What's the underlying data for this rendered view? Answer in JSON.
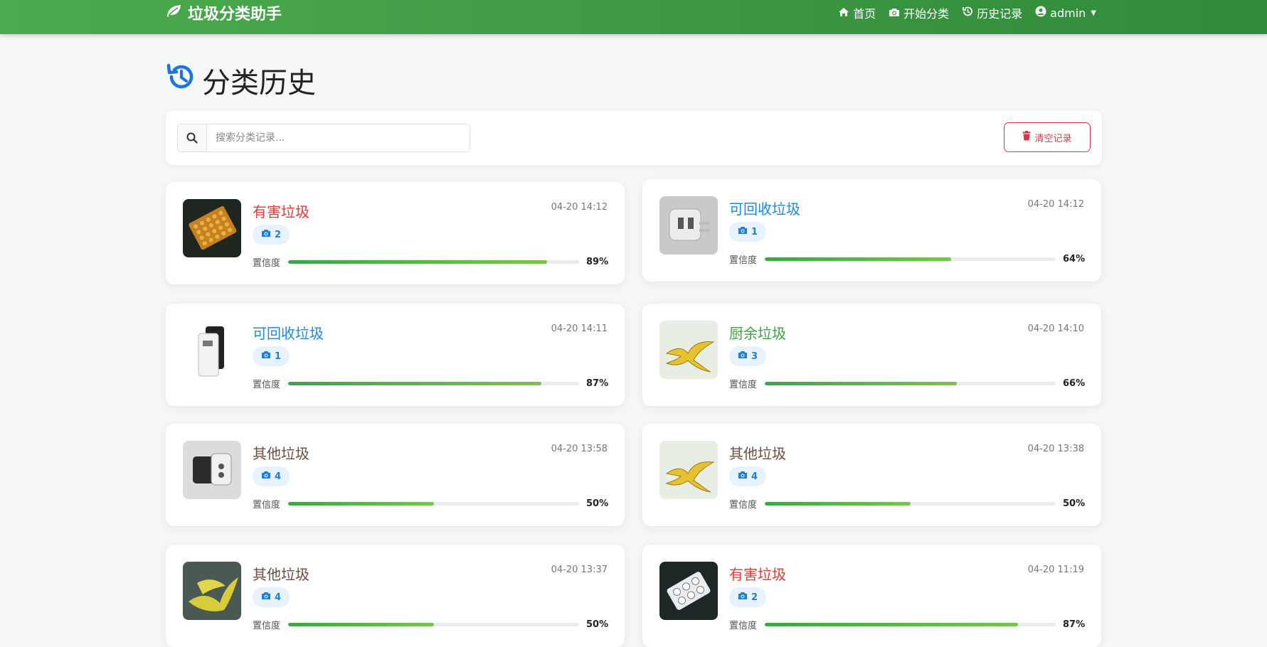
{
  "brand": {
    "title": "垃圾分类助手",
    "icon": "leaf-icon"
  },
  "nav": {
    "home": "首页",
    "classify": "开始分类",
    "history": "历史记录",
    "user": "admin"
  },
  "page": {
    "title": "分类历史"
  },
  "search": {
    "placeholder": "搜索分类记录..."
  },
  "clear_button": "清空记录",
  "confidence_label": "置信度",
  "colors": {
    "nav_green": "#3f9a44",
    "hazardous": "#e53935",
    "recyclable": "#1e88e5",
    "kitchen": "#43a047",
    "other": "#6d4c41",
    "progress": "#4caf50"
  },
  "records": [
    {
      "category": "有害垃圾",
      "cat_key": "hazardous",
      "count": "2",
      "time": "04-20 14:12",
      "confidence": 0.89,
      "confidence_text": "89%",
      "image": "battery-pack-photo"
    },
    {
      "category": "可回收垃圾",
      "cat_key": "recyclable",
      "count": "1",
      "time": "04-20 14:12",
      "confidence": 0.64,
      "confidence_text": "64%",
      "image": "plug-adapter-photo"
    },
    {
      "category": "可回收垃圾",
      "cat_key": "recyclable",
      "count": "1",
      "time": "04-20 14:11",
      "confidence": 0.87,
      "confidence_text": "87%",
      "image": "power-bank-photo"
    },
    {
      "category": "厨余垃圾",
      "cat_key": "kitchen",
      "count": "3",
      "time": "04-20 14:10",
      "confidence": 0.66,
      "confidence_text": "66%",
      "image": "banana-peel-photo"
    },
    {
      "category": "其他垃圾",
      "cat_key": "other",
      "count": "4",
      "time": "04-20 13:58",
      "confidence": 0.5,
      "confidence_text": "50%",
      "image": "adapter-photo"
    },
    {
      "category": "其他垃圾",
      "cat_key": "other",
      "count": "4",
      "time": "04-20 13:38",
      "confidence": 0.5,
      "confidence_text": "50%",
      "image": "banana-peel-photo"
    },
    {
      "category": "其他垃圾",
      "cat_key": "other",
      "count": "4",
      "time": "04-20 13:37",
      "confidence": 0.5,
      "confidence_text": "50%",
      "image": "banana-peels-photo"
    },
    {
      "category": "有害垃圾",
      "cat_key": "hazardous",
      "count": "2",
      "time": "04-20 11:19",
      "confidence": 0.87,
      "confidence_text": "87%",
      "image": "pill-blister-photo"
    }
  ]
}
